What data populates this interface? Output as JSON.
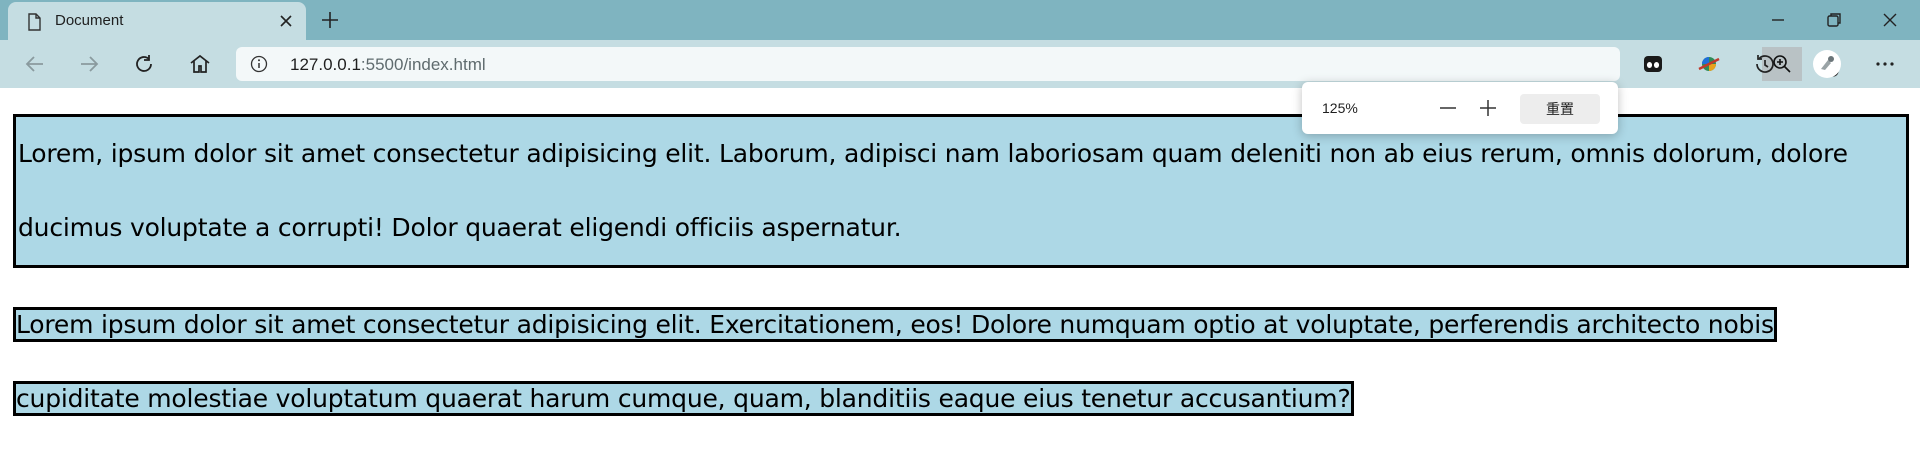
{
  "browser": {
    "tab": {
      "title": "Document"
    },
    "address": {
      "host": "127.0.0.1",
      "path": ":5500/index.html"
    },
    "zoom_popup": {
      "level": "125%",
      "reset_label": "重置"
    }
  },
  "page": {
    "paragraph1": "Lorem, ipsum dolor sit amet consectetur adipisicing elit. Laborum, adipisci nam laboriosam quam deleniti non ab eius rerum, omnis dolorum, dolore ducimus voluptate a corrupti! Dolor quaerat eligendi officiis aspernatur.",
    "paragraph2": "Lorem ipsum dolor sit amet consectetur adipisicing elit. Exercitationem, eos! Dolore numquam optio at voluptate, perferendis architecto nobis cupiditate molestiae voluptatum quaerat harum cumque, quam, blanditiis eaque eius tenetur accusantium?"
  },
  "colors": {
    "tabstrip": "#7fb4c0",
    "toolbar": "#c5dde2",
    "block_bg": "#add8e6",
    "block_border": "#000000"
  },
  "icons": [
    "document-icon",
    "close-icon",
    "plus-icon",
    "minimize-icon",
    "restore-icon",
    "back-icon",
    "forward-icon",
    "refresh-icon",
    "home-icon",
    "info-icon",
    "zoom-icon",
    "favorite-add-icon",
    "extension-icon",
    "colorful-extension-icon",
    "history-icon",
    "profile-avatar",
    "more-icon",
    "minus-icon"
  ]
}
